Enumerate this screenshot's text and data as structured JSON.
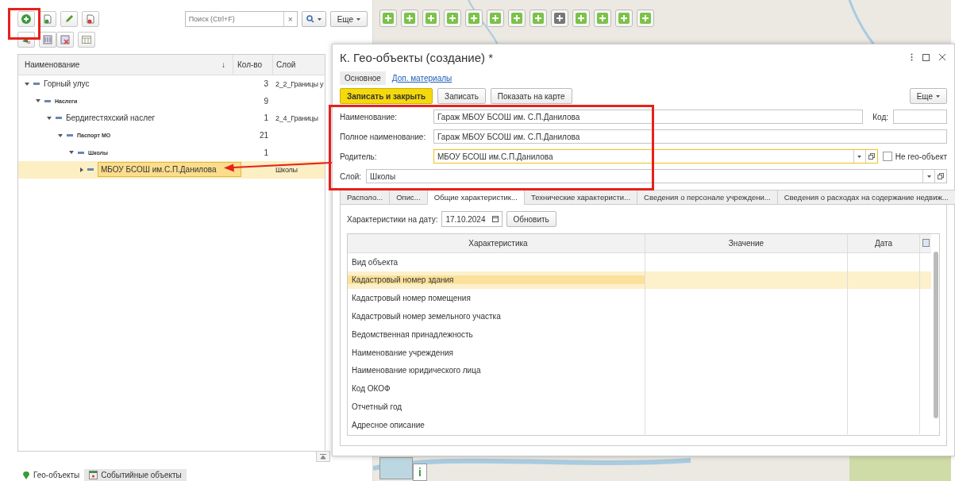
{
  "left_panel": {
    "search": {
      "placeholder": "Поиск (Ctrl+F)"
    },
    "clear_button": "×",
    "more_button": "Еще",
    "columns": [
      "Наименование",
      "↓",
      "Кол-во",
      "Слой"
    ],
    "tree": [
      {
        "name": "Горный улус",
        "kind": "item",
        "count": "3",
        "layer": "2_2_Границы у",
        "expanded": true,
        "selected": false,
        "children": [
          {
            "name": "Наслеги",
            "kind": "group",
            "count": "9",
            "expanded": true,
            "selected": false,
            "children": [
              {
                "name": "Бердигестяхский наслег",
                "kind": "item",
                "count": "1",
                "layer": "2_4_Границы",
                "expanded": true,
                "selected": false,
                "children": [
                  {
                    "name": "Паспорт МО",
                    "kind": "group",
                    "count": "21",
                    "expanded": true,
                    "selected": false,
                    "children": [
                      {
                        "name": "Школы",
                        "kind": "group",
                        "count": "1",
                        "expanded": true,
                        "selected": false,
                        "children": [
                          {
                            "name": "МБОУ БСОШ им.С.П.Данилова",
                            "kind": "item",
                            "layer": "Школы",
                            "expanded": false,
                            "selected": true
                          }
                        ]
                      }
                    ]
                  }
                ]
              }
            ]
          }
        ]
      }
    ]
  },
  "bottom_tabs": [
    {
      "label": "Гео-объекты",
      "selected": true
    },
    {
      "label": "Событийные объекты",
      "selected": false
    }
  ],
  "map": {
    "info_button": "i"
  },
  "dialog": {
    "title": "К. Гео-объекты (создание) *",
    "tabs": [
      {
        "label": "Основное",
        "selected": true
      },
      {
        "label": "Доп. материалы",
        "selected": false
      }
    ],
    "buttons": [
      {
        "label": "Записать и закрыть",
        "kind": "primary"
      },
      {
        "label": "Записать",
        "kind": "normal"
      },
      {
        "label": "Показать на карте",
        "kind": "normal"
      }
    ],
    "more_button": "Еще",
    "name": {
      "label": "Наименование:",
      "value": "Гараж МБОУ БСОШ им. С.П.Данилова"
    },
    "code": {
      "label": "Код:"
    },
    "full_name": {
      "label": "Полное наименование:",
      "value": "Гараж МБОУ БСОШ им. С.П.Данилова"
    },
    "parent": {
      "label": "Родитель:",
      "value": "МБОУ БСОШ им.С.П.Данилова"
    },
    "not_geo": {
      "label": "Не гео-объект",
      "checked": false
    },
    "layer": {
      "label": "Слой:",
      "value": "Школы"
    },
    "subtabs": [
      {
        "label": "Располо...",
        "selected": false
      },
      {
        "label": "Опис...",
        "selected": false
      },
      {
        "label": "Общие характеристик...",
        "selected": true
      },
      {
        "label": "Технические характеристи...",
        "selected": false
      },
      {
        "label": "Сведения о персонале учреждени...",
        "selected": false
      },
      {
        "label": "Сведения о расходах на содержание недвиж...",
        "selected": false
      }
    ],
    "date_label": "Характеристики на дату:",
    "date_value": "17.10.2024",
    "refresh_button": "Обновить",
    "table_columns": [
      "Характеристика",
      "Значение",
      "Дата"
    ],
    "rows": [
      {
        "name": "Вид объекта",
        "selected": false
      },
      {
        "name": "Кадастровый номер здания",
        "selected": true
      },
      {
        "name": "Кадастровый номер помещения",
        "selected": false
      },
      {
        "name": "Кадастровый номер земельного участка",
        "selected": false
      },
      {
        "name": "Ведомственная принадлежность",
        "selected": false
      },
      {
        "name": "Наименование учреждения",
        "selected": false
      },
      {
        "name": "Наименование юридического лица",
        "selected": false
      },
      {
        "name": "Код ОКОФ",
        "selected": false
      },
      {
        "name": "Отчетный год",
        "selected": false
      },
      {
        "name": "Адресное описание",
        "selected": false
      }
    ]
  }
}
